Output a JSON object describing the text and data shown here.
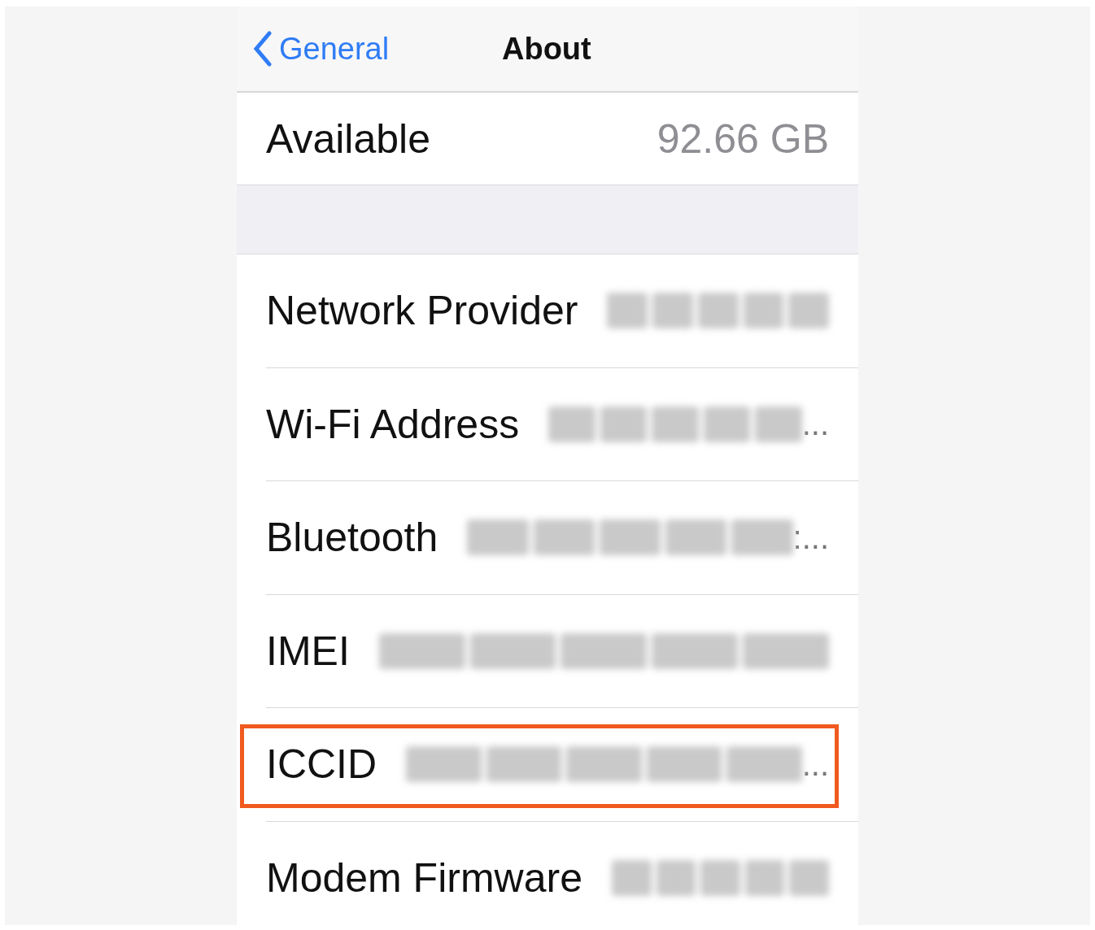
{
  "nav": {
    "back": "General",
    "title": "About"
  },
  "sections": [
    {
      "rows": [
        {
          "label": "Available",
          "value": "92.66 GB",
          "redacted": false,
          "highlighted": false
        }
      ]
    },
    {
      "rows": [
        {
          "label": "Network Provider",
          "redacted": true,
          "highlighted": false
        },
        {
          "label": "Wi-Fi Address",
          "redacted": true,
          "trail": "...",
          "highlighted": false
        },
        {
          "label": "Bluetooth",
          "redacted": true,
          "trail": ":...",
          "highlighted": false
        },
        {
          "label": "IMEI",
          "redacted": true,
          "highlighted": false
        },
        {
          "label": "ICCID",
          "redacted": true,
          "trail": "...",
          "highlighted": true
        },
        {
          "label": "Modem Firmware",
          "redacted": true,
          "highlighted": false
        }
      ]
    }
  ]
}
